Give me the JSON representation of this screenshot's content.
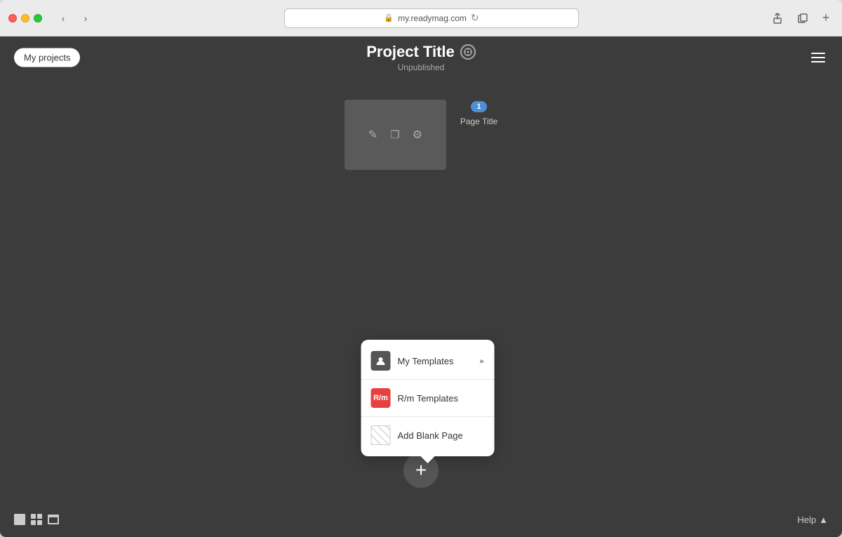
{
  "browser": {
    "address": "my.readymag.com",
    "traffic_lights": [
      "red",
      "yellow",
      "green"
    ],
    "add_tab_label": "+"
  },
  "header": {
    "back_button_label": "My projects",
    "project_title": "Project Title",
    "project_status": "Unpublished",
    "hamburger_label": "Menu"
  },
  "page": {
    "number_badge": "1",
    "title_label": "Page Title",
    "edit_icon": "✎",
    "copy_icon": "⧉",
    "settings_icon": "⚙"
  },
  "popup_menu": {
    "items": [
      {
        "id": "my-templates",
        "icon_type": "person",
        "label": "My Templates",
        "has_arrow": true,
        "arrow_label": "▸"
      },
      {
        "id": "rm-templates",
        "icon_type": "rm",
        "icon_text": "R/m",
        "label": "R/m Templates",
        "has_arrow": false
      },
      {
        "id": "add-blank",
        "icon_type": "blank",
        "label": "Add Blank Page",
        "has_arrow": false
      }
    ]
  },
  "bottom_bar": {
    "help_label": "Help",
    "help_arrow": "▲",
    "view_icons": [
      "single",
      "grid",
      "archive"
    ]
  },
  "add_button_label": "+"
}
